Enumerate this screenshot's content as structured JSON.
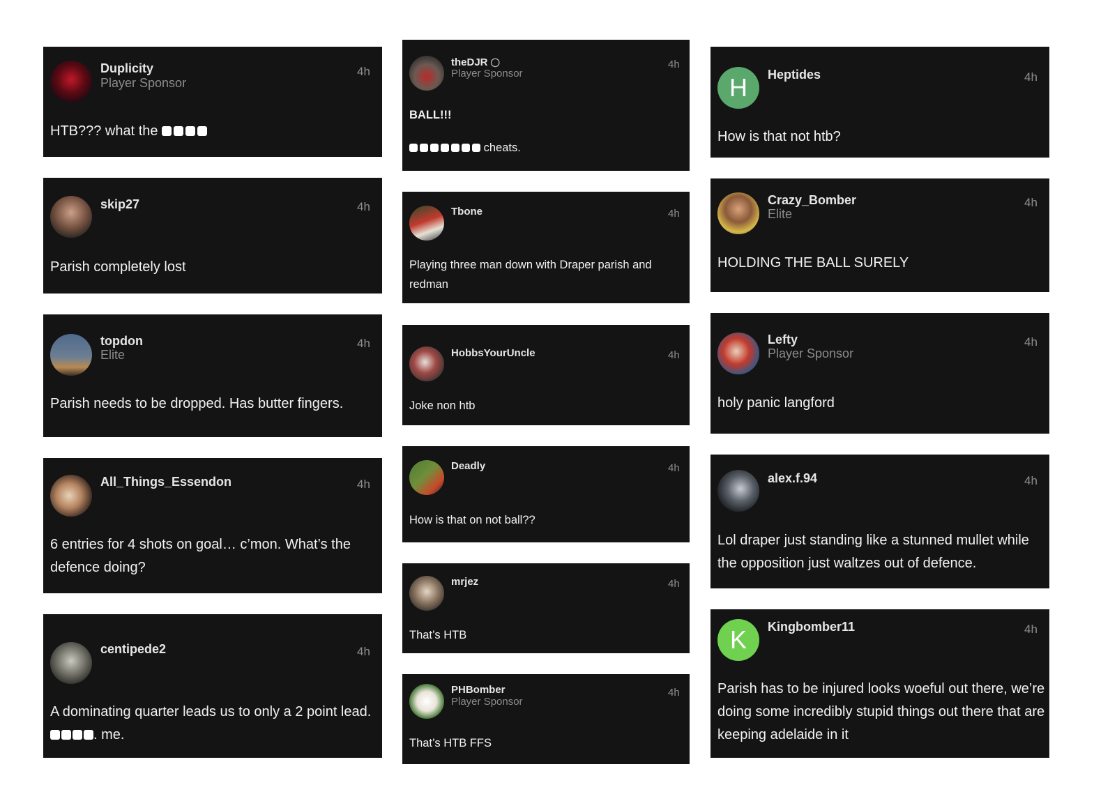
{
  "posts": [
    {
      "user": "Duplicity",
      "role": "Player Sponsor",
      "time": "4h",
      "text": "HTB??? what the ■■■■"
    },
    {
      "user": "skip27",
      "time": "4h",
      "text": "Parish completely lost"
    },
    {
      "user": "topdon",
      "role": "Elite",
      "time": "4h",
      "text": "Parish needs to be dropped. Has butter fingers."
    },
    {
      "user": "All_Things_Essendon",
      "time": "4h",
      "text": "6 entries for 4 shots on goal… c’mon. What’s the defence doing?"
    },
    {
      "user": "centipede2",
      "time": "4h",
      "text_before": "A dominating quarter leads us to only a 2 point lead.",
      "text_redacted": "■■■■",
      "text_after": ". me."
    },
    {
      "user": "theDJR",
      "role": "Player Sponsor",
      "time": "4h",
      "headline": "BALL!!!",
      "text_redacted": "■■■■■■■",
      "text_after": "cheats."
    },
    {
      "user": "Tbone",
      "time": "4h",
      "text": "Playing three man down with Draper parish and redman"
    },
    {
      "user": "HobbsYourUncle",
      "time": "4h",
      "text": "Joke non htb"
    },
    {
      "user": "Deadly",
      "time": "4h",
      "text": "How is that on not ball??"
    },
    {
      "user": "mrjez",
      "time": "4h",
      "text": "That’s HTB"
    },
    {
      "user": "PHBomber",
      "role": "Player Sponsor",
      "time": "4h",
      "text": "That’s HTB FFS"
    },
    {
      "user": "Heptides",
      "avatar_letter": "H",
      "avatar_color": "#5aa86c",
      "time": "4h",
      "text": "How is that not htb?"
    },
    {
      "user": "Crazy_Bomber",
      "role": "Elite",
      "time": "4h",
      "text": "HOLDING THE BALL SURELY"
    },
    {
      "user": "Lefty",
      "role": "Player Sponsor",
      "time": "4h",
      "text": "holy panic langford"
    },
    {
      "user": "alex.f.94",
      "time": "4h",
      "text": "Lol draper just standing like a stunned mullet while the opposition just waltzes out of defence."
    },
    {
      "user": "Kingbomber11",
      "avatar_letter": "K",
      "avatar_color": "#6fd14f",
      "time": "4h",
      "text": "Parish has to be injured looks woeful out there, we’re doing some incredibly stupid things out there that are keeping adelaide in it"
    }
  ],
  "colors": {
    "card_bg": "#141414",
    "page_bg": "#ffffff",
    "username": "#e6e6e6",
    "muted": "#8c8c8c"
  }
}
